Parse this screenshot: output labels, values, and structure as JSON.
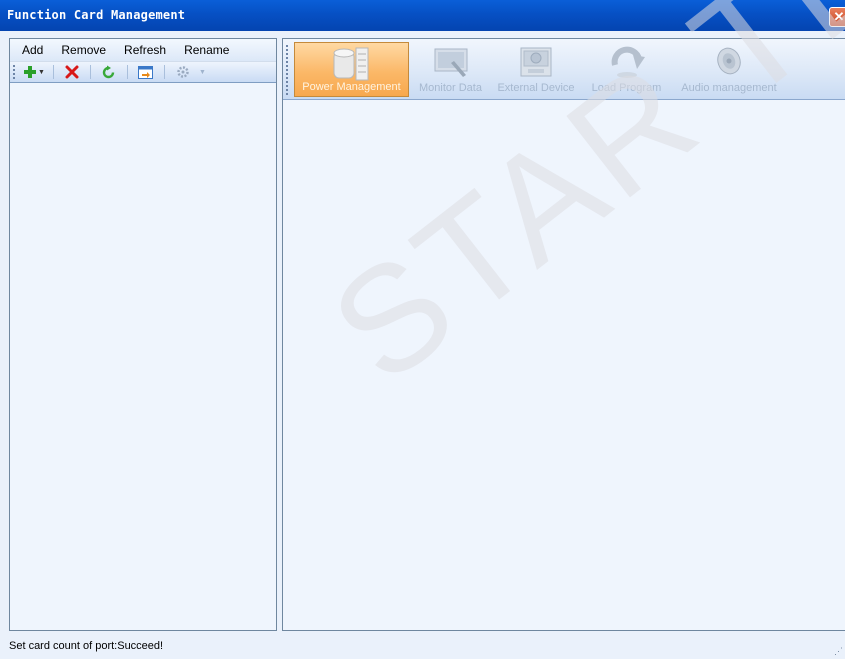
{
  "window": {
    "title": "Function Card Management",
    "close_label": "✕"
  },
  "left": {
    "menu": [
      "Add",
      "Remove",
      "Refresh",
      "Rename"
    ],
    "toolbar_icons": [
      "add-icon",
      "delete-icon",
      "refresh-icon",
      "rename-icon",
      "settings-icon"
    ]
  },
  "right": {
    "tabs": [
      {
        "label": "Power Management",
        "icon": "power-management-icon",
        "active": true
      },
      {
        "label": "Monitor Data",
        "icon": "monitor-data-icon",
        "active": false
      },
      {
        "label": "External Device",
        "icon": "external-device-icon",
        "active": false
      },
      {
        "label": "Load Program",
        "icon": "load-program-icon",
        "active": false
      },
      {
        "label": "Audio management",
        "icon": "audio-management-icon",
        "active": false
      }
    ]
  },
  "watermark": "STAR TECH CO.,",
  "status": {
    "message": "Set card count of port:Succeed!"
  }
}
